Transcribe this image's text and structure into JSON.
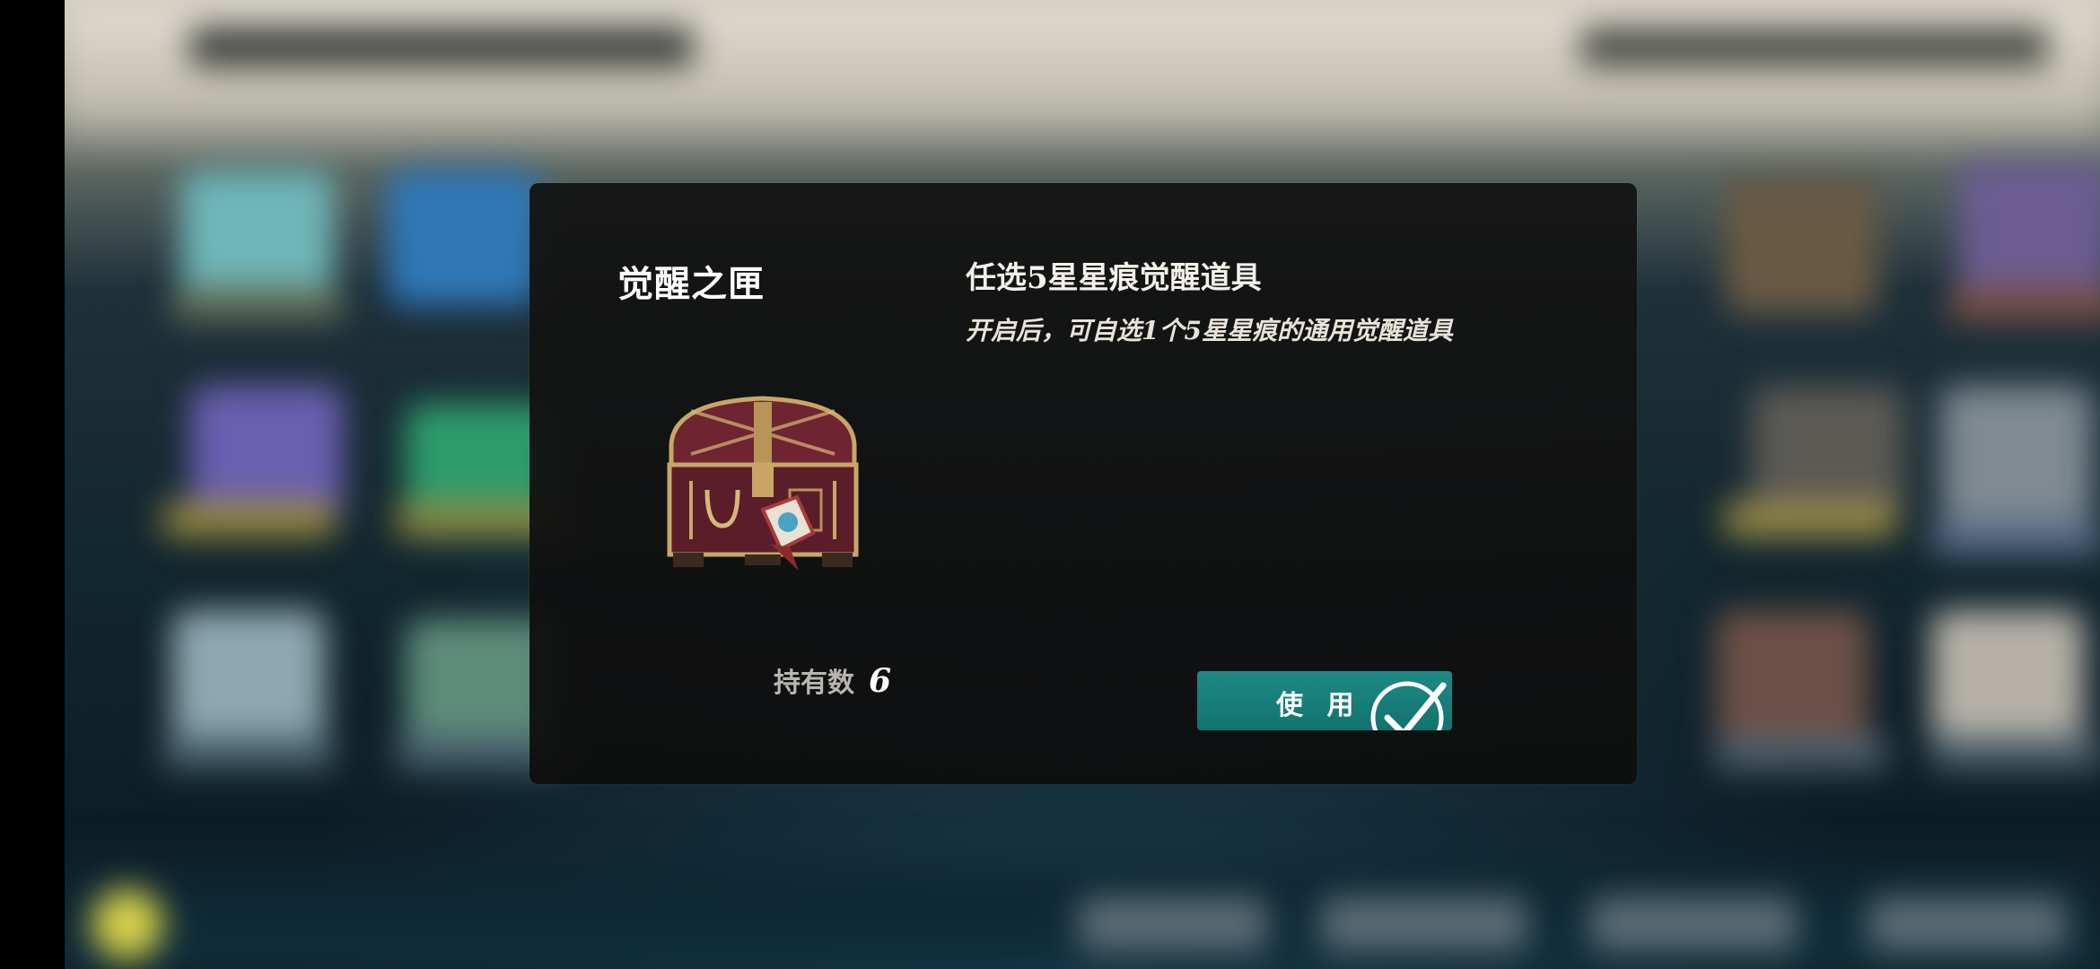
{
  "dialog": {
    "item_name": "觉醒之匣",
    "subtitle": "任选5星星痕觉醒道具",
    "description": "开启后，可自选1个5星星痕的通用觉醒道具",
    "held_label": "持有数",
    "held_count": "6",
    "use_button_label": "使 用"
  },
  "icons": {
    "item": "treasure-chest-icon",
    "confirm": "check-circle-icon"
  },
  "colors": {
    "use_button": "#1d8a85",
    "dialog_bg": "#151515"
  }
}
